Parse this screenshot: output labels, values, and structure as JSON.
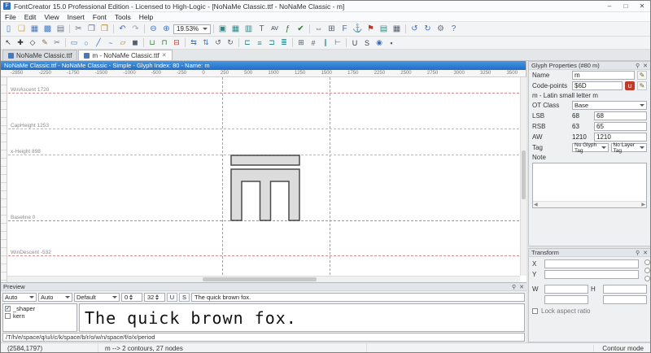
{
  "window": {
    "title": "FontCreator 15.0 Professional Edition - Licensed to High-Logic - [NoNaMe Classic.ttf - NoNaMe Classic - m]",
    "app_badge": "F",
    "minimize": "–",
    "maximize": "□",
    "close": "✕"
  },
  "menu": {
    "items": [
      "File",
      "Edit",
      "View",
      "Insert",
      "Font",
      "Tools",
      "Help"
    ]
  },
  "icons": {
    "pencil": "✎",
    "pin": "⚲",
    "close": "✕",
    "left_arrow": "◀",
    "right_arrow": "▶",
    "check": "✔",
    "unicode_badge": "u"
  },
  "toolbar1": {
    "zoom_value": "19.53%",
    "icons": [
      {
        "name": "new-document",
        "glyph": "▯",
        "color": "#4a78b8"
      },
      {
        "name": "open",
        "glyph": "❏",
        "color": "#d9a33b"
      },
      {
        "name": "save",
        "glyph": "▦",
        "color": "#4a78b8"
      },
      {
        "name": "save-all",
        "glyph": "▩",
        "color": "#4a78b8"
      },
      {
        "name": "print",
        "glyph": "▤",
        "color": "#667085"
      },
      {
        "name": "cut",
        "glyph": "✂",
        "color": "#667085"
      },
      {
        "name": "copy",
        "glyph": "❐",
        "color": "#667085"
      },
      {
        "name": "paste",
        "glyph": "❒",
        "color": "#b08030"
      },
      {
        "name": "undo",
        "glyph": "↶",
        "color": "#3a6fbf"
      },
      {
        "name": "redo",
        "glyph": "↷",
        "color": "#9aa3ad"
      },
      {
        "name": "zoom-out",
        "glyph": "⊖",
        "color": "#3a6fbf"
      },
      {
        "name": "zoom-in",
        "glyph": "⊕",
        "color": "#3a6fbf"
      },
      {
        "name": "glyph-overview",
        "glyph": "▣",
        "color": "#2e8b8b"
      },
      {
        "name": "font-overview",
        "glyph": "▦",
        "color": "#2e8b8b"
      },
      {
        "name": "comparison",
        "glyph": "▥",
        "color": "#2e8b8b"
      },
      {
        "name": "test-font",
        "glyph": "T",
        "color": "#c0392b"
      },
      {
        "name": "kerning",
        "glyph": "AV",
        "color": "#334155"
      },
      {
        "name": "opentype-designer",
        "glyph": "ƒ",
        "color": "#2e7d32"
      },
      {
        "name": "validate",
        "glyph": "✔",
        "color": "#2e7d32"
      },
      {
        "name": "autometrics",
        "glyph": "⇔",
        "color": "#556070"
      },
      {
        "name": "complete-composites",
        "glyph": "⊞",
        "color": "#556070"
      },
      {
        "name": "font-properties",
        "glyph": "F",
        "color": "#3a6fbf"
      },
      {
        "name": "anchor",
        "glyph": "⚓",
        "color": "#3a6fbf"
      },
      {
        "name": "flag",
        "glyph": "⚑",
        "color": "#c0392b"
      },
      {
        "name": "tables",
        "glyph": "▤",
        "color": "#2e8b8b"
      },
      {
        "name": "grid",
        "glyph": "▦",
        "color": "#556070"
      },
      {
        "name": "rotate-left",
        "glyph": "↺",
        "color": "#3a6fbf"
      },
      {
        "name": "rotate-right",
        "glyph": "↻",
        "color": "#3a6fbf"
      },
      {
        "name": "settings",
        "glyph": "⚙",
        "color": "#667085"
      },
      {
        "name": "help",
        "glyph": "?",
        "color": "#3a6fbf"
      }
    ]
  },
  "toolbar2": {
    "icons": [
      {
        "name": "select-tool",
        "glyph": "↖",
        "color": "#333"
      },
      {
        "name": "contour-tool",
        "glyph": "✚",
        "color": "#333"
      },
      {
        "name": "point-tool",
        "glyph": "◇",
        "color": "#333"
      },
      {
        "name": "pen-tool",
        "glyph": "✎",
        "color": "#8a6d3b"
      },
      {
        "name": "knife-tool",
        "glyph": "✂",
        "color": "#667085"
      },
      {
        "name": "rectangle-tool",
        "glyph": "▭",
        "color": "#3a6fbf"
      },
      {
        "name": "ellipse-tool",
        "glyph": "○",
        "color": "#3a6fbf"
      },
      {
        "name": "line-tool",
        "glyph": "╱",
        "color": "#3a6fbf"
      },
      {
        "name": "freehand-tool",
        "glyph": "~",
        "color": "#3a6fbf"
      },
      {
        "name": "eraser-tool",
        "glyph": "▱",
        "color": "#b08030"
      },
      {
        "name": "fill-tool",
        "glyph": "◼",
        "color": "#556070"
      },
      {
        "name": "union",
        "glyph": "⊔",
        "color": "#2e7d32"
      },
      {
        "name": "intersect",
        "glyph": "⊓",
        "color": "#2e7d32"
      },
      {
        "name": "exclude",
        "glyph": "⊟",
        "color": "#c0392b"
      },
      {
        "name": "flip-horizontal",
        "glyph": "⇆",
        "color": "#3a6fbf"
      },
      {
        "name": "flip-vertical",
        "glyph": "⇅",
        "color": "#3a6fbf"
      },
      {
        "name": "rotate-ccw",
        "glyph": "↺",
        "color": "#556070"
      },
      {
        "name": "rotate-cw",
        "glyph": "↻",
        "color": "#556070"
      },
      {
        "name": "align-left",
        "glyph": "⊏",
        "color": "#2e8b8b"
      },
      {
        "name": "align-center",
        "glyph": "≡",
        "color": "#2e8b8b"
      },
      {
        "name": "align-right",
        "glyph": "⊐",
        "color": "#2e8b8b"
      },
      {
        "name": "distribute",
        "glyph": "≣",
        "color": "#2e8b8b"
      },
      {
        "name": "snap-to-grid",
        "glyph": "⊞",
        "color": "#556070"
      },
      {
        "name": "snap-to-guides",
        "glyph": "#",
        "color": "#556070"
      },
      {
        "name": "guidelines",
        "glyph": "∥",
        "color": "#2e8b8b"
      },
      {
        "name": "metrics-lines",
        "glyph": "⊢",
        "color": "#556070"
      },
      {
        "name": "underline-toggle",
        "glyph": "U",
        "color": "#334155"
      },
      {
        "name": "strike-toggle",
        "glyph": "S",
        "color": "#334155"
      },
      {
        "name": "preview-toggle",
        "glyph": "◉",
        "color": "#3a6fbf"
      },
      {
        "name": "lock-toggle",
        "glyph": "▪",
        "color": "#556070"
      }
    ]
  },
  "tabs": [
    {
      "label": "NoNaMe Classic.ttf"
    },
    {
      "label": "m - NoNaMe Classic.ttf"
    }
  ],
  "editor": {
    "header": "NoNaMe Classic.ttf - NoNaMe Classic - Simple - Glyph Index: 80 - Name: m",
    "ruler_labels": [
      "-2850",
      "-2250",
      "-1750",
      "-1500",
      "-1000",
      "-500",
      "-250",
      "0",
      "250",
      "500",
      "1000",
      "1250",
      "1500",
      "1750",
      "2250",
      "2500",
      "2750",
      "3000",
      "3250",
      "3500"
    ],
    "guides": [
      {
        "label": "WinAscent 1720"
      },
      {
        "label": "CapHeight 1253"
      },
      {
        "label": "x-Height 898"
      },
      {
        "label": "Baseline 0"
      },
      {
        "label": "WinDescent -532"
      }
    ],
    "glyph_fill": "#dcdcdc",
    "glyph_stroke": "#4a4a4a"
  },
  "glyph_properties": {
    "title": "Glyph Properties (#80 m)",
    "name_label": "Name",
    "name_value": "m",
    "codepoints_label": "Code-points",
    "codepoints_value": "$6D",
    "description": "m - Latin small letter m",
    "ot_class_label": "OT Class",
    "ot_class_value": "Base",
    "lsb_label": "LSB",
    "lsb_static": "68",
    "lsb_value": "68",
    "rsb_label": "RSB",
    "rsb_static": "63",
    "rsb_value": "65",
    "aw_label": "AW",
    "aw_static": "1210",
    "aw_value": "1210",
    "tag_label": "Tag",
    "glyph_tag_value": "No Glyph Tag",
    "layer_tag_value": "No Layer Tag",
    "note_label": "Note",
    "note_value": ""
  },
  "transform": {
    "title": "Transform",
    "x_label": "X",
    "x_value": "",
    "y_label": "Y",
    "y_value": "",
    "w_label": "W",
    "w_value": "",
    "h_label": "H",
    "h_value": "",
    "scale_x_value": "",
    "scale_y_value": "",
    "lock_label": "Lock aspect ratio"
  },
  "preview": {
    "title": "Preview",
    "combo1": "Auto",
    "combo2": "Auto",
    "combo3": "Default",
    "spinner_value": "0",
    "size_value": "32",
    "underline_btn": "U",
    "strike_btn": "S",
    "sample_input": "The quick brown fox.",
    "list_items": [
      {
        "label": "_shaper",
        "mark": "✔"
      },
      {
        "label": "kern",
        "mark": ""
      }
    ],
    "preview_text": "The quick brown fox.",
    "path_input": "/T/h/e/space/q/u/i/c/k/space/b/r/o/w/n/space/f/o/x/period"
  },
  "status_bar": {
    "coords": "(2584,1797)",
    "glyph_info": "m -->  2 contours, 27 nodes",
    "mode": "Contour mode"
  }
}
